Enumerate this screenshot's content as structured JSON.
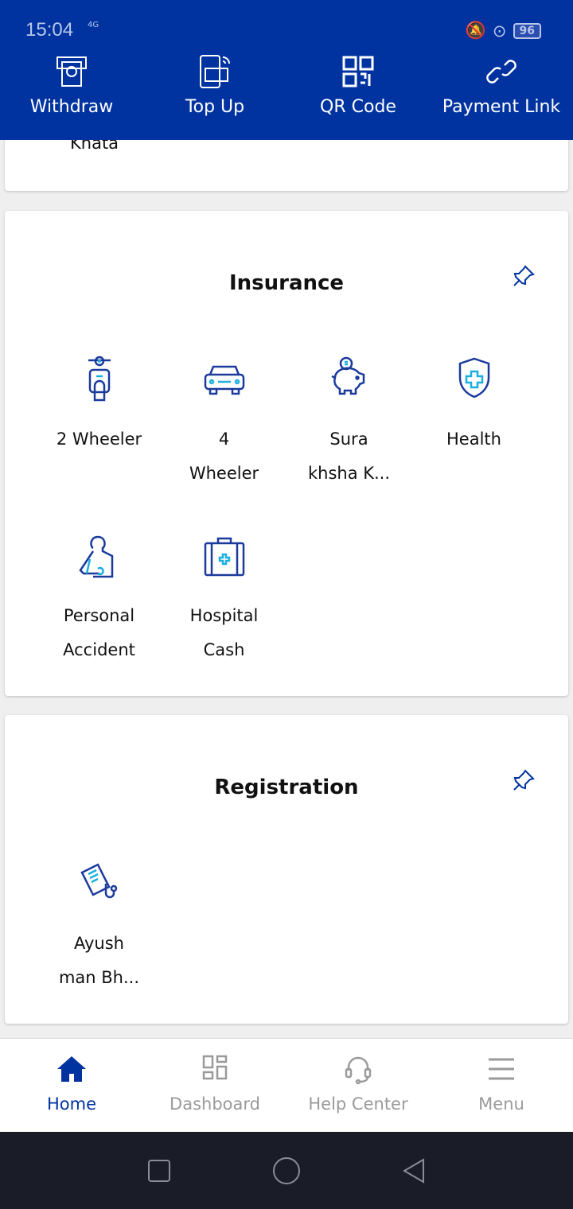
{
  "status": {
    "time": "15:04",
    "network": "4G",
    "battery": "96"
  },
  "quick_actions": [
    {
      "label": "Withdraw",
      "icon": "atm-withdraw-icon"
    },
    {
      "label": "Top Up",
      "icon": "phone-card-icon"
    },
    {
      "label": "QR Code",
      "icon": "qr-code-icon"
    },
    {
      "label": "Payment Link",
      "icon": "link-icon"
    }
  ],
  "prev_card": {
    "partial_label": "Khata"
  },
  "insurance": {
    "title": "Insurance",
    "items": [
      {
        "label": "2 Wheeler"
      },
      {
        "label": "4\nWheeler"
      },
      {
        "label": "Sura\nkhsha K..."
      },
      {
        "label": "Health"
      },
      {
        "label": "Personal\nAccident"
      },
      {
        "label": "Hospital\nCash"
      }
    ]
  },
  "registration": {
    "title": "Registration",
    "items": [
      {
        "label": "Ayush\nman Bh..."
      }
    ]
  },
  "bottom_nav": [
    {
      "label": "Home",
      "active": true
    },
    {
      "label": "Dashboard"
    },
    {
      "label": "Help Center"
    },
    {
      "label": "Menu"
    }
  ],
  "colors": {
    "primary": "#0033a0",
    "icon_dark": "#1a3a9c",
    "icon_accent": "#1ab0e0",
    "nav_inactive": "#9a9a9a"
  }
}
